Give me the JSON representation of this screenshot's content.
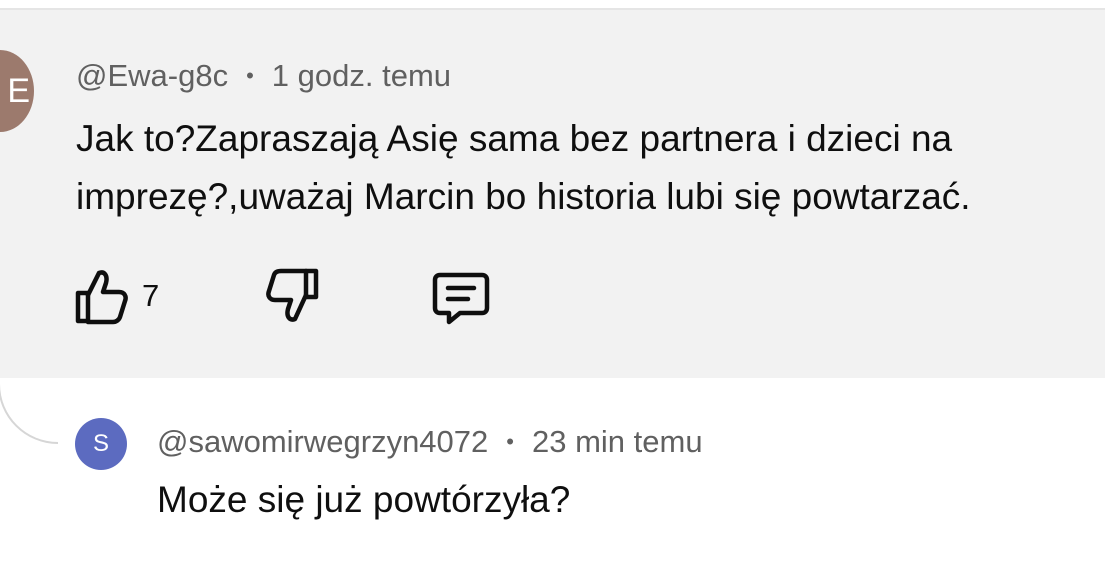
{
  "comment": {
    "avatar_letter": "E",
    "avatar_color": "#9c7a6d",
    "author": "@Ewa-g8c",
    "separator": "•",
    "time": "1 godz. temu",
    "text": "Jak to?Zapraszają Asię sama bez partnera i dzieci na imprezę?,uważaj Marcin bo historia lubi się powtarzać.",
    "likes": "7",
    "icons": [
      "thumbs-up-icon",
      "thumbs-down-icon",
      "reply-comment-icon"
    ]
  },
  "reply": {
    "avatar_letter": "S",
    "avatar_color": "#5c6bc0",
    "author": "@sawomirwegrzyn4072",
    "separator": "•",
    "time": "23 min temu",
    "text": "Może się już powtórzyła?"
  }
}
